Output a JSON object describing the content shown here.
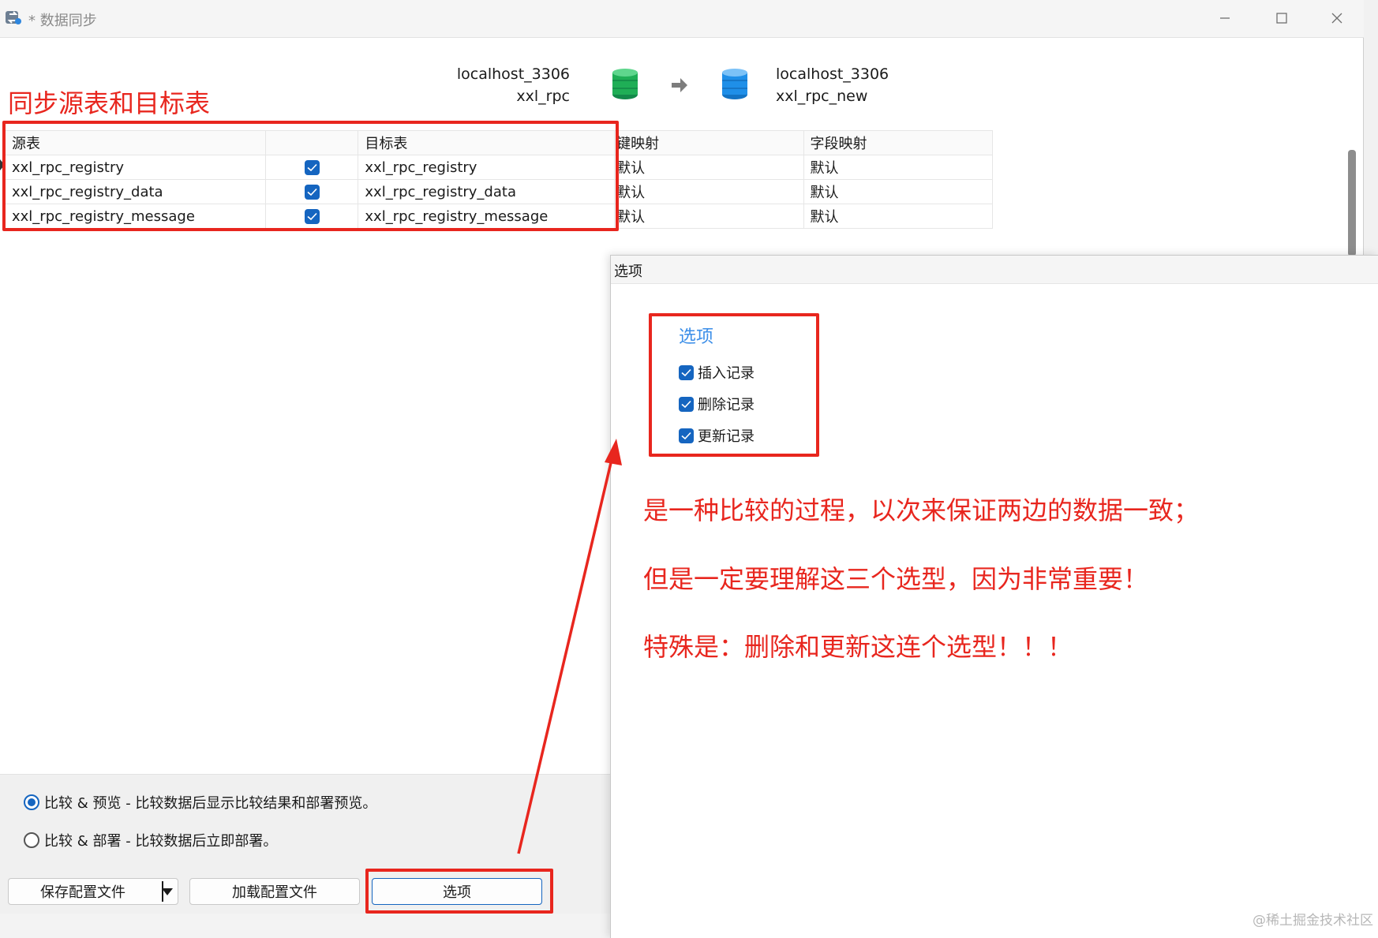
{
  "window": {
    "title": "* 数据同步"
  },
  "connection": {
    "source": {
      "server": "localhost_3306",
      "database": "xxl_rpc"
    },
    "target": {
      "server": "localhost_3306",
      "database": "xxl_rpc_new"
    }
  },
  "annotations": {
    "table_note": "同步源表和目标表",
    "note_1": "是一种比较的过程，以次来保证两边的数据一致；",
    "note_2": "但是一定要理解这三个选型，因为非常重要！",
    "note_3": "特殊是：删除和更新这连个选型！！！",
    "color": "#e8261e"
  },
  "table": {
    "headers": [
      "源表",
      "",
      "目标表",
      "键映射",
      "字段映射"
    ],
    "rows": [
      {
        "source": "xxl_rpc_registry",
        "checked": true,
        "target": "xxl_rpc_registry",
        "key_map": "默认",
        "field_map": "默认"
      },
      {
        "source": "xxl_rpc_registry_data",
        "checked": true,
        "target": "xxl_rpc_registry_data",
        "key_map": "默认",
        "field_map": "默认"
      },
      {
        "source": "xxl_rpc_registry_message",
        "checked": true,
        "target": "xxl_rpc_registry_message",
        "key_map": "默认",
        "field_map": "默认"
      }
    ]
  },
  "modes": [
    {
      "label": "比较 & 预览 - 比较数据后显示比较结果和部署预览。",
      "selected": true
    },
    {
      "label": "比较 & 部署 - 比较数据后立即部署。",
      "selected": false
    }
  ],
  "buttons": {
    "save_config": "保存配置文件",
    "load_config": "加载配置文件",
    "options": "选项"
  },
  "dialog": {
    "title": "选项",
    "group_title": "选项",
    "options": [
      {
        "label": "插入记录",
        "checked": true
      },
      {
        "label": "删除记录",
        "checked": true
      },
      {
        "label": "更新记录",
        "checked": true
      }
    ]
  },
  "watermark": "@稀土掘金技术社区",
  "colors": {
    "accent": "#1565c0",
    "source_db": "#1fae56",
    "target_db": "#1f8fe8",
    "link_blue": "#3b8ee8"
  }
}
